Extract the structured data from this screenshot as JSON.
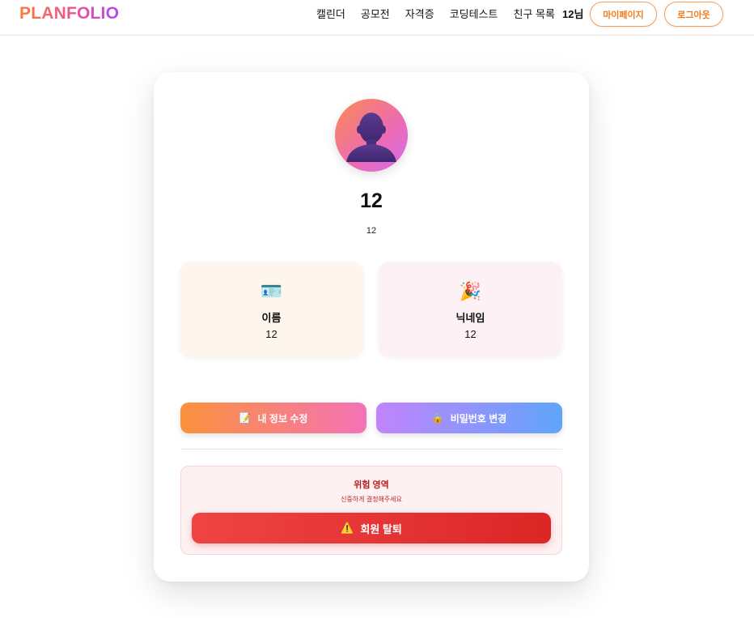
{
  "header": {
    "logo": "PLANFOLIO",
    "nav": [
      "캘린더",
      "공모전",
      "자격증",
      "코딩테스트",
      "친구 목록"
    ],
    "greeting": "12님",
    "mypage_label": "마이페이지",
    "logout_label": "로그아웃"
  },
  "profile": {
    "name": "12",
    "subtitle": "12"
  },
  "info_cards": [
    {
      "icon": "🪪",
      "label": "이름",
      "value": "12"
    },
    {
      "icon": "🎉",
      "label": "닉네임",
      "value": "12"
    }
  ],
  "actions": {
    "edit_icon": "📝",
    "edit_label": "내 정보 수정",
    "password_icon": "🔒",
    "password_label": "비밀번호 변경"
  },
  "danger": {
    "title": "위험 영역",
    "subtitle": "신중하게 결정해주세요",
    "withdraw_icon": "⚠️",
    "withdraw_label": "회원 탈퇴"
  },
  "colors": {
    "accent_orange": "#f07b1e",
    "danger_red": "#dc2626"
  }
}
